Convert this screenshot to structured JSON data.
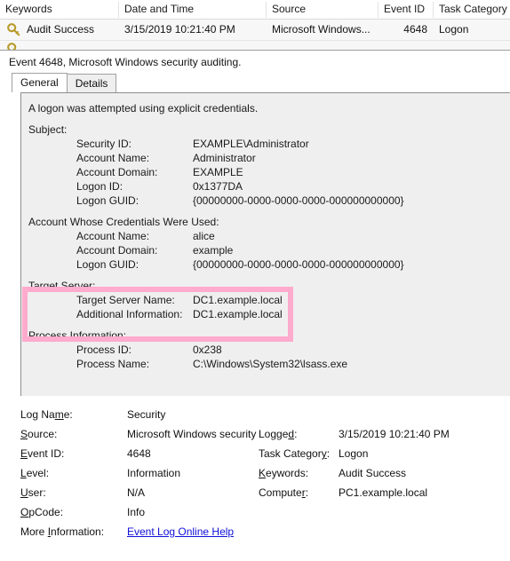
{
  "event_list": {
    "columns": [
      {
        "key": "keywords",
        "label": "Keywords"
      },
      {
        "key": "datetime",
        "label": "Date and Time"
      },
      {
        "key": "source",
        "label": "Source"
      },
      {
        "key": "event_id",
        "label": "Event ID"
      },
      {
        "key": "task_category",
        "label": "Task Category"
      }
    ],
    "rows": [
      {
        "icon": "key-icon",
        "keywords": "Audit Success",
        "datetime": "3/15/2019 10:21:40 PM",
        "source": "Microsoft Windows...",
        "event_id": "4648",
        "task_category": "Logon"
      }
    ]
  },
  "event_header": {
    "title": "Event 4648, Microsoft Windows security auditing."
  },
  "tabs": [
    {
      "label": "General",
      "active": true
    },
    {
      "label": "Details",
      "active": false
    }
  ],
  "detail": {
    "summary": "A logon was attempted using explicit credentials.",
    "sections": [
      {
        "heading": "Subject:",
        "fields": [
          {
            "label": "Security ID:",
            "value": "EXAMPLE\\Administrator"
          },
          {
            "label": "Account Name:",
            "value": "Administrator"
          },
          {
            "label": "Account Domain:",
            "value": "EXAMPLE"
          },
          {
            "label": "Logon ID:",
            "value": "0x1377DA"
          },
          {
            "label": "Logon GUID:",
            "value": "{00000000-0000-0000-0000-000000000000}"
          }
        ]
      },
      {
        "heading": "Account Whose Credentials Were Used:",
        "fields": [
          {
            "label": "Account Name:",
            "value": "alice"
          },
          {
            "label": "Account Domain:",
            "value": "example"
          },
          {
            "label": "Logon GUID:",
            "value": "{00000000-0000-0000-0000-000000000000}"
          }
        ]
      },
      {
        "heading": "Target Server:",
        "highlighted": true,
        "fields": [
          {
            "label": "Target Server Name:",
            "value": "DC1.example.local"
          },
          {
            "label": "Additional Information:",
            "value": "DC1.example.local"
          }
        ]
      },
      {
        "heading": "Process Information:",
        "fields": [
          {
            "label": "Process ID:",
            "value": "0x238"
          },
          {
            "label": "Process Name:",
            "value": "C:\\Windows\\System32\\lsass.exe"
          }
        ]
      }
    ]
  },
  "metadata": {
    "left": [
      {
        "label_pre": "Log Na",
        "label_acc": "m",
        "label_post": "e:",
        "value": "Security"
      },
      {
        "label_pre": "",
        "label_acc": "S",
        "label_post": "ource:",
        "value": "Microsoft Windows security"
      },
      {
        "label_pre": "",
        "label_acc": "E",
        "label_post": "vent ID:",
        "value": "4648"
      },
      {
        "label_pre": "",
        "label_acc": "L",
        "label_post": "evel:",
        "value": "Information"
      },
      {
        "label_pre": "",
        "label_acc": "U",
        "label_post": "ser:",
        "value": "N/A"
      },
      {
        "label_pre": "",
        "label_acc": "O",
        "label_post": "pCode:",
        "value": "Info"
      }
    ],
    "right": [
      {
        "label_pre": "Logge",
        "label_acc": "d",
        "label_post": ":",
        "value": "3/15/2019 10:21:40 PM"
      },
      {
        "label_pre": "Task Categor",
        "label_acc": "y",
        "label_post": ":",
        "value": "Logon"
      },
      {
        "label_pre": "",
        "label_acc": "K",
        "label_post": "eywords:",
        "value": "Audit Success"
      },
      {
        "label_pre": "Compute",
        "label_acc": "r",
        "label_post": ":",
        "value": "PC1.example.local"
      }
    ],
    "more_info": {
      "label_pre": "More ",
      "label_acc": "I",
      "label_post": "nformation:",
      "link_text": "Event Log Online Help"
    }
  },
  "colors": {
    "highlight_pink": "#ffabcd",
    "link_blue": "#0f0fd8",
    "detail_bg": "#efefef",
    "row_bg": "#f7f7f7"
  }
}
